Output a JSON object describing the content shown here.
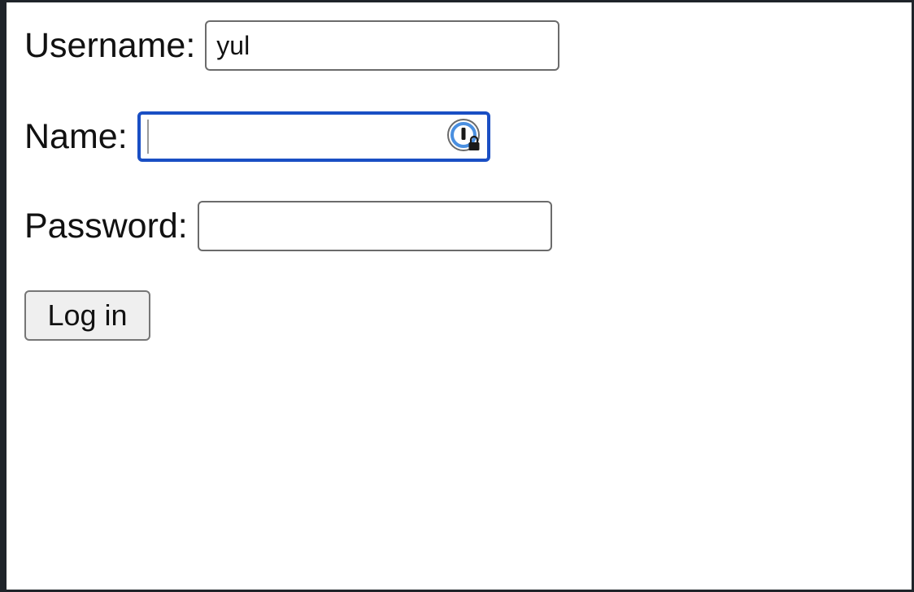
{
  "form": {
    "username": {
      "label": "Username:",
      "value": "yul"
    },
    "name": {
      "label": "Name:",
      "value": "",
      "focused": true,
      "autofill_icon": "password-manager-lock-icon"
    },
    "password": {
      "label": "Password:",
      "value": ""
    },
    "login_button_label": "Log in"
  },
  "colors": {
    "focus_ring": "#1a4fc4",
    "icon_accent": "#4a8fe0"
  }
}
